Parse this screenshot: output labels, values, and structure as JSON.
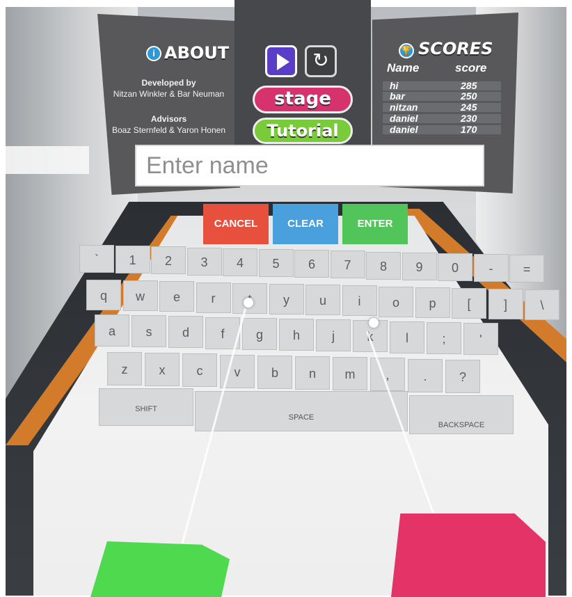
{
  "about": {
    "title": "ABOUT",
    "developed_label": "Developed by",
    "developers": "Nitzan Winkler & Bar Neuman",
    "advisors_label": "Advisors",
    "advisors": "Boaz Sternfeld & Yaron Honen"
  },
  "menu": {
    "play_icon": "play-icon",
    "reset_icon": "reset-icon",
    "stage_label": "stage",
    "tutorial_label": "Tutorial"
  },
  "scores": {
    "title": "SCORES",
    "name_header": "Name",
    "score_header": "score",
    "rows": [
      {
        "name": "hi",
        "score": "285"
      },
      {
        "name": "bar",
        "score": "250"
      },
      {
        "name": "nitzan",
        "score": "245"
      },
      {
        "name": "daniel",
        "score": "230"
      },
      {
        "name": "daniel",
        "score": "170"
      }
    ]
  },
  "name_input": {
    "placeholder": "Enter name"
  },
  "actions": {
    "cancel": "CANCEL",
    "clear": "CLEAR",
    "enter": "ENTER"
  },
  "keyboard": {
    "row1": [
      "`",
      "1",
      "2",
      "3",
      "4",
      "5",
      "6",
      "7",
      "8",
      "9",
      "0",
      "-",
      "="
    ],
    "row2": [
      "q",
      "w",
      "e",
      "r",
      "t",
      "y",
      "u",
      "i",
      "o",
      "p",
      "[",
      "]",
      "\\"
    ],
    "row3": [
      "a",
      "s",
      "d",
      "f",
      "g",
      "h",
      "j",
      "k",
      "l",
      ";",
      "'"
    ],
    "row4": [
      "z",
      "x",
      "c",
      "v",
      "b",
      "n",
      "m",
      ",",
      ".",
      "?"
    ],
    "shift": "SHIFT",
    "space": "SPACE",
    "backspace": "BACKSPACE"
  },
  "colors": {
    "cancel": "#e8503e",
    "clear": "#4aa0dc",
    "enter": "#52c55a",
    "stage": "#d6336c",
    "tutorial": "#7acb3a",
    "left_controller": "#4fd94f",
    "right_controller": "#e43467"
  }
}
